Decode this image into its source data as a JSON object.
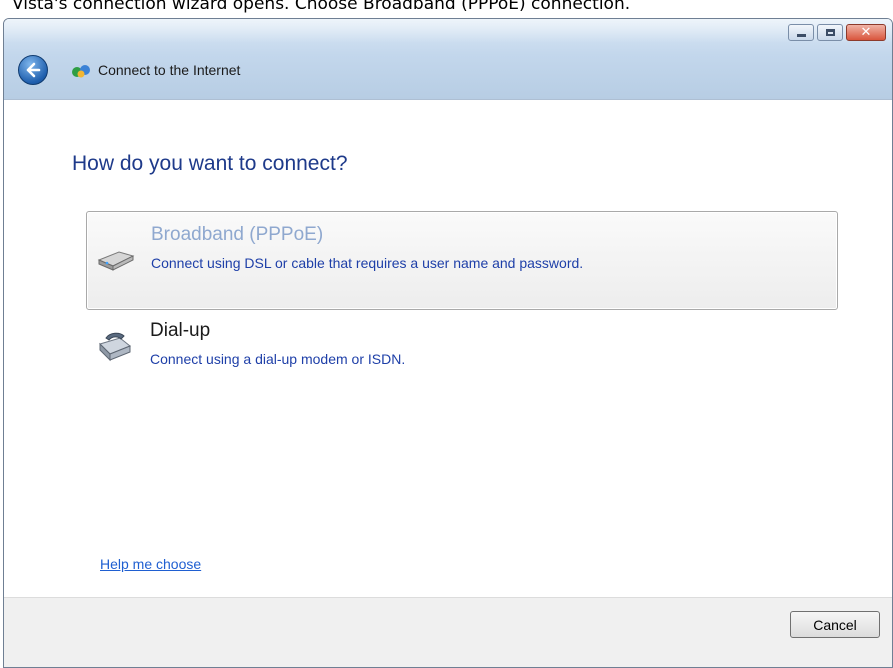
{
  "caption": "Vista's connection wizard opens. Choose Broadband (PPPoE) connection.",
  "window": {
    "title": "Connect to the Internet",
    "controls": {
      "minimize": "minimize",
      "maximize": "maximize",
      "close": "✕"
    }
  },
  "wizard": {
    "heading": "How do you want to connect?",
    "options": [
      {
        "title": "Broadband (PPPoE)",
        "description": "Connect using DSL or cable that requires a user name and password.",
        "icon": "broadband-modem-icon",
        "selected": true
      },
      {
        "title": "Dial-up",
        "description": "Connect using a dial-up modem or ISDN.",
        "icon": "dialup-phone-icon",
        "selected": false
      }
    ],
    "help_link": "Help me choose"
  },
  "footer": {
    "cancel_label": "Cancel"
  },
  "colors": {
    "heading": "#1e3a8a",
    "description": "#1e3fa8",
    "selected_title": "#8fa8cf",
    "link": "#1f5fd1"
  }
}
